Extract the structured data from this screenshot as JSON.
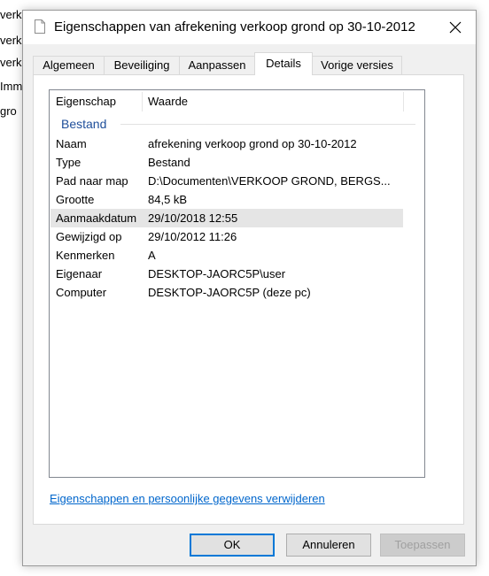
{
  "background_window": {
    "lines": [
      "verko",
      "verko",
      "verko",
      "Imm",
      "gro"
    ]
  },
  "dialog": {
    "title": "Eigenschappen van afrekening verkoop grond op 30-10-2012",
    "close_glyph": "✕"
  },
  "tabs": [
    {
      "label": "Algemeen",
      "active": false
    },
    {
      "label": "Beveiliging",
      "active": false
    },
    {
      "label": "Aanpassen",
      "active": false
    },
    {
      "label": "Details",
      "active": true
    },
    {
      "label": "Vorige versies",
      "active": false
    }
  ],
  "details": {
    "headers": {
      "property": "Eigenschap",
      "value": "Waarde"
    },
    "group": "Bestand",
    "rows": [
      {
        "key": "Naam",
        "value": "afrekening verkoop grond op 30-10-2012"
      },
      {
        "key": "Type",
        "value": "Bestand"
      },
      {
        "key": "Pad naar map",
        "value": "D:\\Documenten\\VERKOOP GROND, BERGS..."
      },
      {
        "key": "Grootte",
        "value": "84,5 kB"
      },
      {
        "key": "Aanmaakdatum",
        "value": "29/10/2018 12:55"
      },
      {
        "key": "Gewijzigd op",
        "value": "29/10/2012 11:26"
      },
      {
        "key": "Kenmerken",
        "value": "A"
      },
      {
        "key": "Eigenaar",
        "value": "DESKTOP-JAORC5P\\user"
      },
      {
        "key": "Computer",
        "value": "DESKTOP-JAORC5P (deze pc)"
      }
    ]
  },
  "link": {
    "remove": "Eigenschappen en persoonlijke gegevens verwijderen"
  },
  "buttons": {
    "ok": "OK",
    "cancel": "Annuleren",
    "apply": "Toepassen"
  },
  "colors": {
    "accent": "#0078d7",
    "link": "#0066cc",
    "group": "#1e4e9a"
  }
}
